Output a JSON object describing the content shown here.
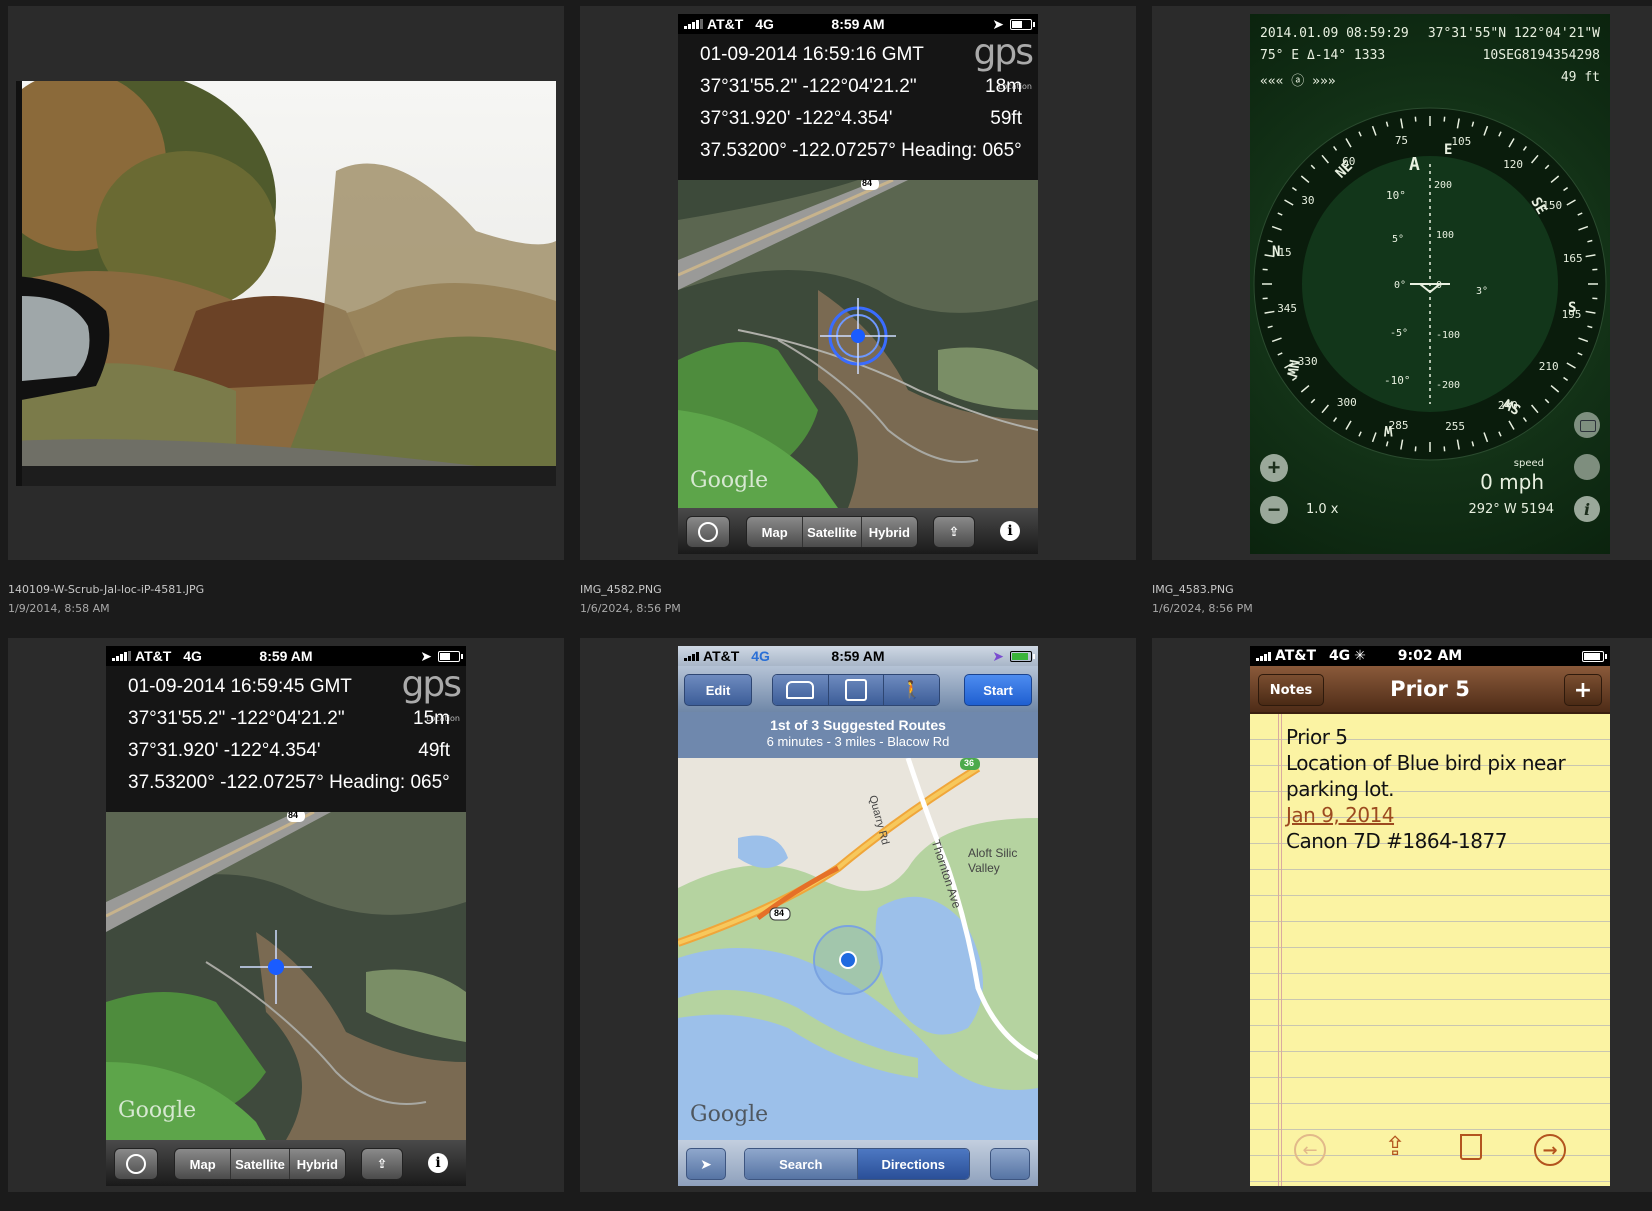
{
  "gallery": {
    "items": [
      {
        "filename": "140109-W-Scrub-Jal-loc-iP-4581.JPG",
        "date": "1/9/2014, 8:58 AM"
      },
      {
        "filename": "IMG_4582.PNG",
        "date": "1/6/2024, 8:56 PM"
      },
      {
        "filename": "IMG_4583.PNG",
        "date": "1/6/2024, 8:56 PM"
      }
    ]
  },
  "status": {
    "carrier": "AT&T",
    "network": "4G",
    "time_a": "8:59 AM",
    "time_b": "9:02 AM"
  },
  "gps1": {
    "row1_left": "01-09-2014  16:59:16 GMT",
    "row2_left": "37°31'55.2\"  -122°04'21.2\"",
    "row2_right": "18m",
    "row3_left": "37°31.920'  -122°4.354'",
    "row3_right": "59ft",
    "row4_left": "37.53200°  -122.07257°  Heading: 065°"
  },
  "gps2": {
    "row1_left": "01-09-2014  16:59:45 GMT",
    "row2_left": "37°31'55.2\"  -122°04'21.2\"",
    "row2_right": "15m",
    "row3_left": "37°31.920'  -122°4.354'",
    "row3_right": "49ft",
    "row4_left": "37.53200°  -122.07257°  Heading: 065°"
  },
  "gps_logo": {
    "big": "gps",
    "small": "Location"
  },
  "map_toolbar": {
    "map": "Map",
    "satellite": "Satellite",
    "hybrid": "Hybrid",
    "info": "i"
  },
  "google_logo": "Google",
  "highway_shield": "84",
  "compass": {
    "datetime": "2014.01.09 08:59:29",
    "coords": "37°31'55\"N 122°04'21\"W",
    "bearing_line": "75° E Δ-14° 1333",
    "grid_ref": "10SEG8194354298",
    "arrows": "«««  ⓐ  »»»",
    "altitude": "49 ft",
    "speed_label": "speed",
    "speed_value": "0 mph",
    "zoom": "1.0 x",
    "heading_bottom": "292°  W 5194",
    "dirs": {
      "n": "N",
      "ne": "NE",
      "e": "E",
      "se": "SE",
      "s": "S",
      "sw": "SW",
      "w": "W",
      "nw": "NW",
      "a": "A"
    },
    "scale": {
      "p10": "10°",
      "p5": "5°",
      "zero": "0°",
      "m5": "-5°",
      "m10": "-10°",
      "r200": "200",
      "r100": "100",
      "r0": "0",
      "rm100": "-100",
      "rm200": "-200",
      "three": "3°"
    },
    "ring_nums": [
      "75",
      "105",
      "120",
      "150",
      "165",
      "195",
      "210",
      "240",
      "255",
      "285",
      "300",
      "330",
      "345",
      "15",
      "30",
      "60"
    ]
  },
  "directions": {
    "edit": "Edit",
    "start": "Start",
    "summary_title": "1st of 3 Suggested Routes",
    "summary_sub": "6 minutes - 3 miles - Blacow Rd",
    "road_quarry": "Quarry Rd",
    "road_thornton": "Thornton Ave",
    "poi": "Aloft Silic Valley",
    "shield_84": "84",
    "shield_36": "36",
    "search": "Search",
    "directions": "Directions"
  },
  "notes": {
    "back": "Notes",
    "title": "Prior 5",
    "add": "+",
    "line1": "Prior 5",
    "line2": "Location of Blue bird pix near",
    "line3": "parking lot.",
    "line4": "Jan 9, 2014",
    "line5": "Canon 7D #1864-1877"
  },
  "colors": {
    "bg": "#1b1b1b",
    "cell": "#2b2b2b",
    "compass_bg": "#0e2a12",
    "notes_paper": "#fbf3a3",
    "ios_blue": "#2a6fd6"
  }
}
